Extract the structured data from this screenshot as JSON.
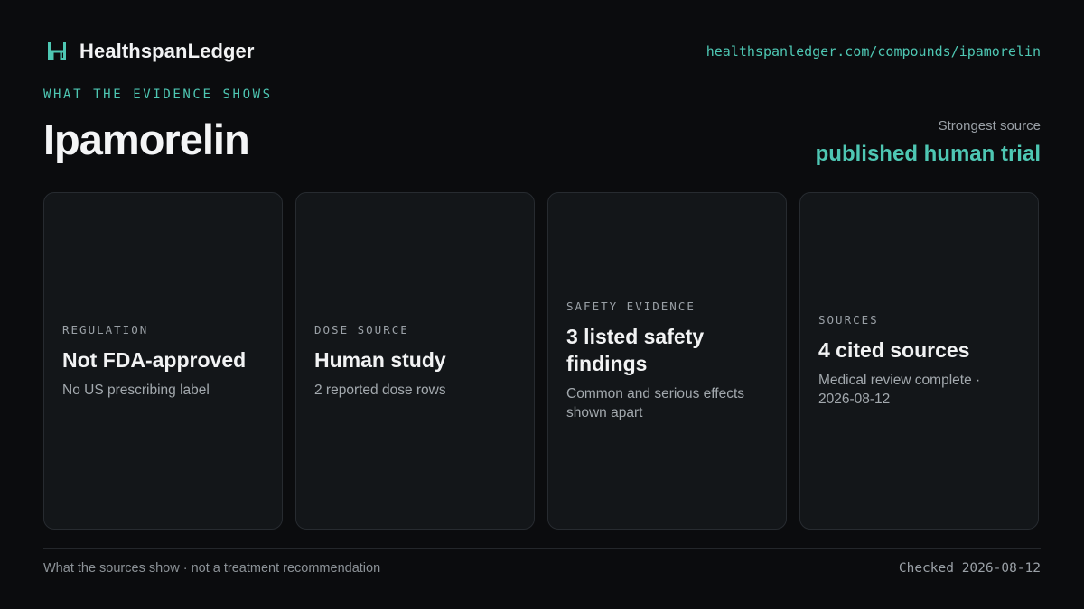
{
  "header": {
    "brand_name": "HealthspanLedger",
    "site_url": "healthspanledger.com/compounds/ipamorelin",
    "logo_icon": "ledger-h-logo-icon"
  },
  "hero": {
    "eyebrow": "WHAT THE EVIDENCE SHOWS",
    "title": "Ipamorelin",
    "strongest_source_label": "Strongest source",
    "strongest_source_value": "published human trial"
  },
  "cards": [
    {
      "eyebrow": "REGULATION",
      "title": "Not FDA-approved",
      "subtitle": "No US prescribing label"
    },
    {
      "eyebrow": "DOSE SOURCE",
      "title": "Human study",
      "subtitle": "2 reported dose rows"
    },
    {
      "eyebrow": "SAFETY EVIDENCE",
      "title": "3 listed safety findings",
      "subtitle": "Common and serious effects shown apart"
    },
    {
      "eyebrow": "SOURCES",
      "title": "4 cited sources",
      "subtitle": "Medical review complete · 2026-08-12"
    }
  ],
  "footer": {
    "disclaimer": "What the sources show · not a treatment recommendation",
    "checked": "Checked 2026-08-12"
  },
  "colors": {
    "background": "#0b0c0e",
    "card_background": "#131619",
    "accent": "#4ec7b3"
  }
}
